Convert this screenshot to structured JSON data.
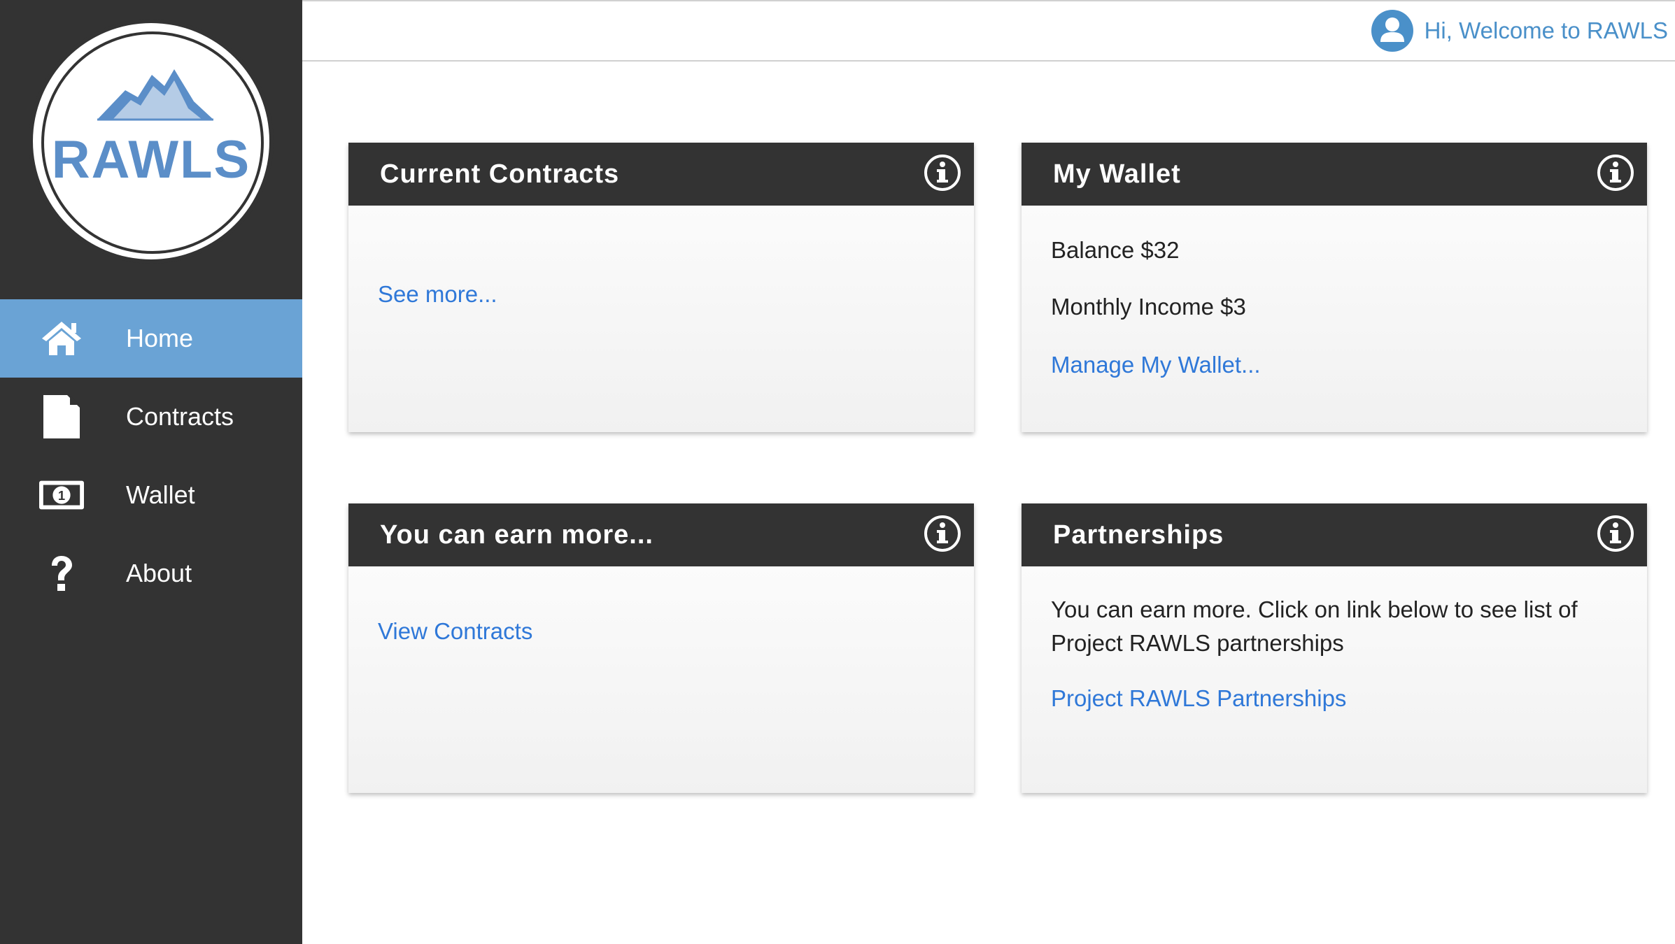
{
  "sidebar": {
    "logo_text": "RAWLS",
    "items": [
      {
        "label": "Home",
        "icon": "home-icon",
        "active": true
      },
      {
        "label": "Contracts",
        "icon": "document-icon",
        "active": false
      },
      {
        "label": "Wallet",
        "icon": "money-icon",
        "active": false
      },
      {
        "label": "About",
        "icon": "question-icon",
        "active": false
      }
    ]
  },
  "topbar": {
    "greeting": "Hi, Welcome to RAWLS",
    "avatar_icon": "user-avatar-icon"
  },
  "cards": {
    "current_contracts": {
      "title": "Current Contracts",
      "link": "See more..."
    },
    "wallet": {
      "title": "My Wallet",
      "balance": "Balance $32",
      "income": "Monthly Income $3",
      "link": "Manage My Wallet..."
    },
    "earn_more": {
      "title": "You can earn more...",
      "link": "View Contracts"
    },
    "partnerships": {
      "title": "Partnerships",
      "text_line1": "You can earn more. Click on link below to see list of",
      "text_line2": "Project RAWLS partnerships",
      "link": "Project RAWLS Partnerships"
    }
  },
  "colors": {
    "sidebar_bg": "#333333",
    "active_nav": "#6aa3d5",
    "accent": "#4a90c9",
    "link": "#2f78d8",
    "logo_text": "#5b8ec8"
  }
}
